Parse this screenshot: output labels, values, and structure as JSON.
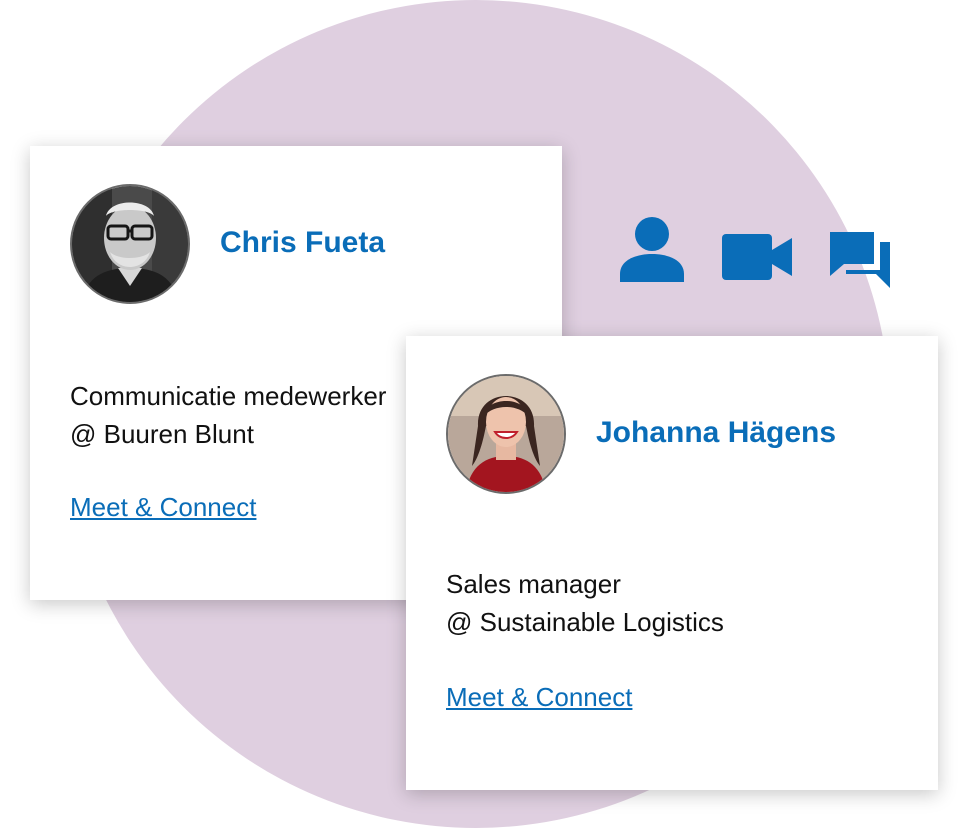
{
  "cards": [
    {
      "name": "Chris Fueta",
      "role_line1": "Communicatie medewerker",
      "role_line2": "@ Buuren Blunt",
      "link": "Meet & Connect"
    },
    {
      "name": "Johanna Hägens",
      "role_line1": "Sales manager",
      "role_line2": "@ Sustainable Logistics",
      "link": "Meet & Connect"
    }
  ],
  "icons": [
    "person-icon",
    "video-camera-icon",
    "chat-icon"
  ],
  "colors": {
    "accent": "#0a6db8",
    "background_circle": "#dfcfe0",
    "card": "#ffffff",
    "text": "#111111"
  }
}
